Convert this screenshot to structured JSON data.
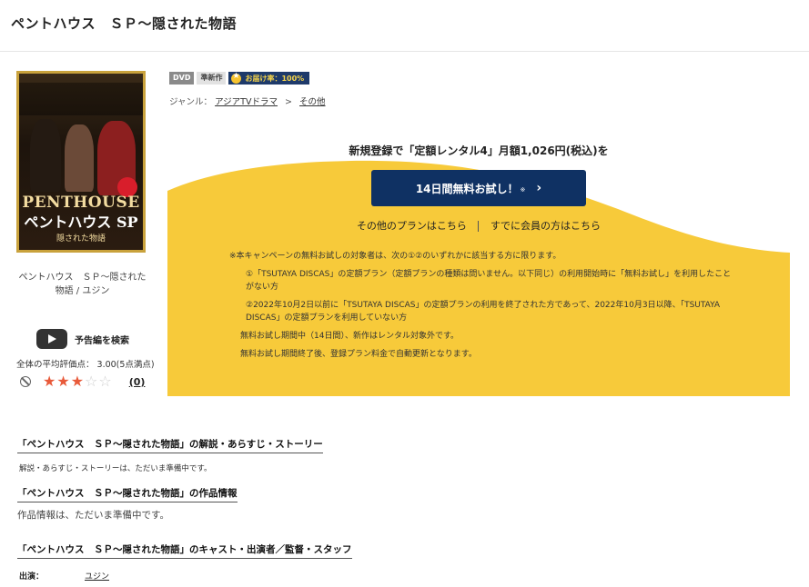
{
  "page": {
    "title": "ペントハウス　ＳＰ～隠された物語"
  },
  "cover": {
    "logo_main": "PENTHOUSE",
    "logo_sub": "ペントハウス SP",
    "logo_tag": "隠された物語"
  },
  "product": {
    "caption": "ペントハウス　ＳＰ～隠された物語 / ユジン",
    "trailer_label": "予告編を検索",
    "rating_summary": "全体の平均評価点： 3.00(5点満点)",
    "stars_filled": 3,
    "stars_total": 5,
    "review_count": "(0)"
  },
  "badges": {
    "dvd": "DVD",
    "new": "準新作",
    "delivery": "お届け率：100%"
  },
  "genre": {
    "label": "ジャンル：",
    "items": [
      "アジアTVドラマ",
      "その他"
    ],
    "separator": ">"
  },
  "campaign": {
    "headline": "新規登録で「定額レンタル4」月額1,026円(税込)を",
    "cta_label": "14日間無料お試し！",
    "cta_note": "※",
    "link_other_plans": "その他のプランはこちら",
    "link_members": "すでに会員の方はこちら",
    "notes": [
      "※本キャンペーンの無料お試しの対象者は、次の①②のいずれかに該当する方に限ります。",
      "①「TSUTAYA DISCAS」の定額プラン（定額プランの種類は問いません。以下同じ）の利用開始時に「無料お試し」を利用したことがない方",
      "②2022年10月2日以前に「TSUTAYA DISCAS」の定額プランの利用を終了された方であって、2022年10月3日以降、「TSUTAYA DISCAS」の定額プランを利用していない方",
      "無料お試し期間中（14日間）、新作はレンタル対象外です。",
      "無料お試し期間終了後、登録プラン料金で自動更新となります。"
    ]
  },
  "sections": {
    "story_heading": "「ペントハウス　ＳＰ～隠された物語」の解説・あらすじ・ストーリー",
    "story_text": "解説・あらすじ・ストーリーは、ただいま準備中です。",
    "info_heading": "「ペントハウス　ＳＰ～隠された物語」の作品情報",
    "info_text": "作品情報は、ただいま準備中です。",
    "cast_heading": "「ペントハウス　ＳＰ～隠された物語」のキャスト・出演者／監督・スタッフ",
    "cast_label": "出演：",
    "cast_value": "ユジン"
  },
  "colors": {
    "campaign_yellow": "#f7ca3a",
    "cta_navy": "#0f3163",
    "star_on": "#e85a3a"
  }
}
